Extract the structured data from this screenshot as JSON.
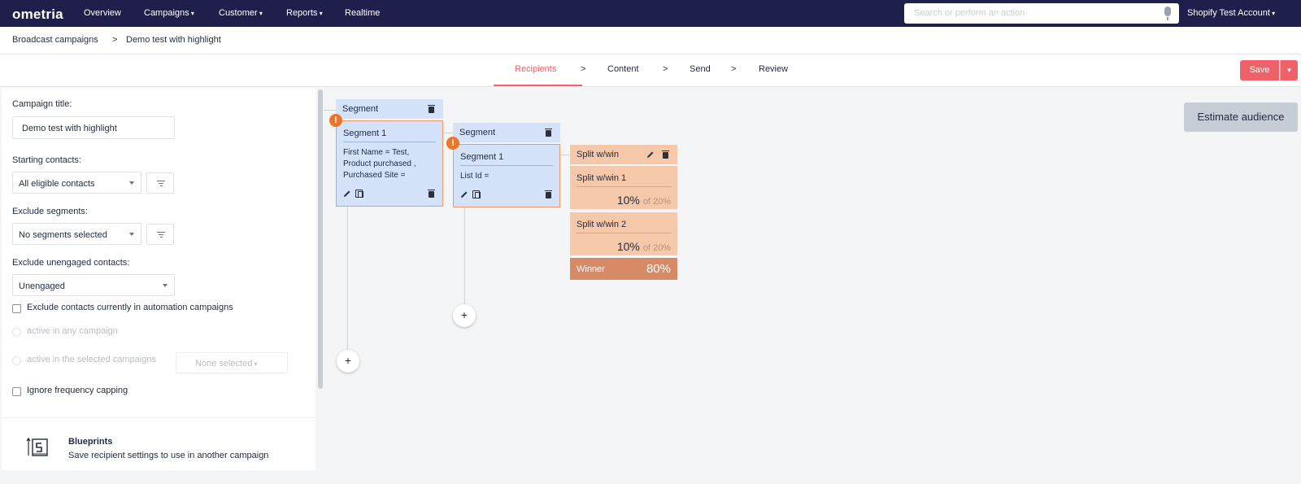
{
  "topnav": {
    "logo": "ometria",
    "items": [
      "Overview",
      "Campaigns",
      "Customer",
      "Reports",
      "Realtime"
    ],
    "search_placeholder": "Search or perform an action",
    "account": "Shopify Test Account"
  },
  "breadcrumb": {
    "parent": "Broadcast campaigns",
    "separator": ">",
    "current": "Demo test with highlight"
  },
  "steps": {
    "items": [
      "Recipients",
      "Content",
      "Send",
      "Review"
    ],
    "separator": ">",
    "active": "Recipients",
    "save_label": "Save"
  },
  "panel": {
    "campaign_title_label": "Campaign title:",
    "campaign_title_value": "Demo test with highlight",
    "starting_contacts_label": "Starting contacts:",
    "starting_contacts_value": "All eligible contacts",
    "exclude_segments_label": "Exclude segments:",
    "exclude_segments_value": "No segments selected",
    "exclude_unengaged_label": "Exclude unengaged contacts:",
    "exclude_unengaged_value": "Unengaged",
    "exclude_automation_label": "Exclude contacts currently in automation campaigns",
    "active_any_label": "active in any campaign",
    "active_selected_label": "active in the selected campaigns",
    "none_selected": "None selected",
    "ignore_frequency_label": "Ignore frequency capping",
    "blueprints_title": "Blueprints",
    "blueprints_desc": "Save recipient settings to use in another campaign"
  },
  "canvas": {
    "segment_a": {
      "header": "Segment",
      "title": "Segment 1",
      "conditions": [
        "First Name = Test,",
        "Product purchased ,",
        "Purchased Site ="
      ]
    },
    "segment_b": {
      "header": "Segment",
      "title": "Segment 1",
      "conditions": [
        "List Id ="
      ]
    },
    "split": {
      "header": "Split w/win",
      "variants": [
        {
          "title": "Split w/win 1",
          "pct": "10%",
          "of": "of 20%"
        },
        {
          "title": "Split w/win 2",
          "pct": "10%",
          "of": "of 20%"
        }
      ],
      "winner_label": "Winner",
      "winner_pct": "80%"
    },
    "warning_glyph": "!",
    "add_glyph": "+",
    "estimate_label": "Estimate audience"
  },
  "colors": {
    "nav_bg": "#1e1f4b",
    "accent": "#f0626a",
    "segment_bg": "#d4e2fa",
    "split_bg": "#f4c8a8",
    "winner_bg": "#d88a66",
    "warning": "#f07426"
  }
}
